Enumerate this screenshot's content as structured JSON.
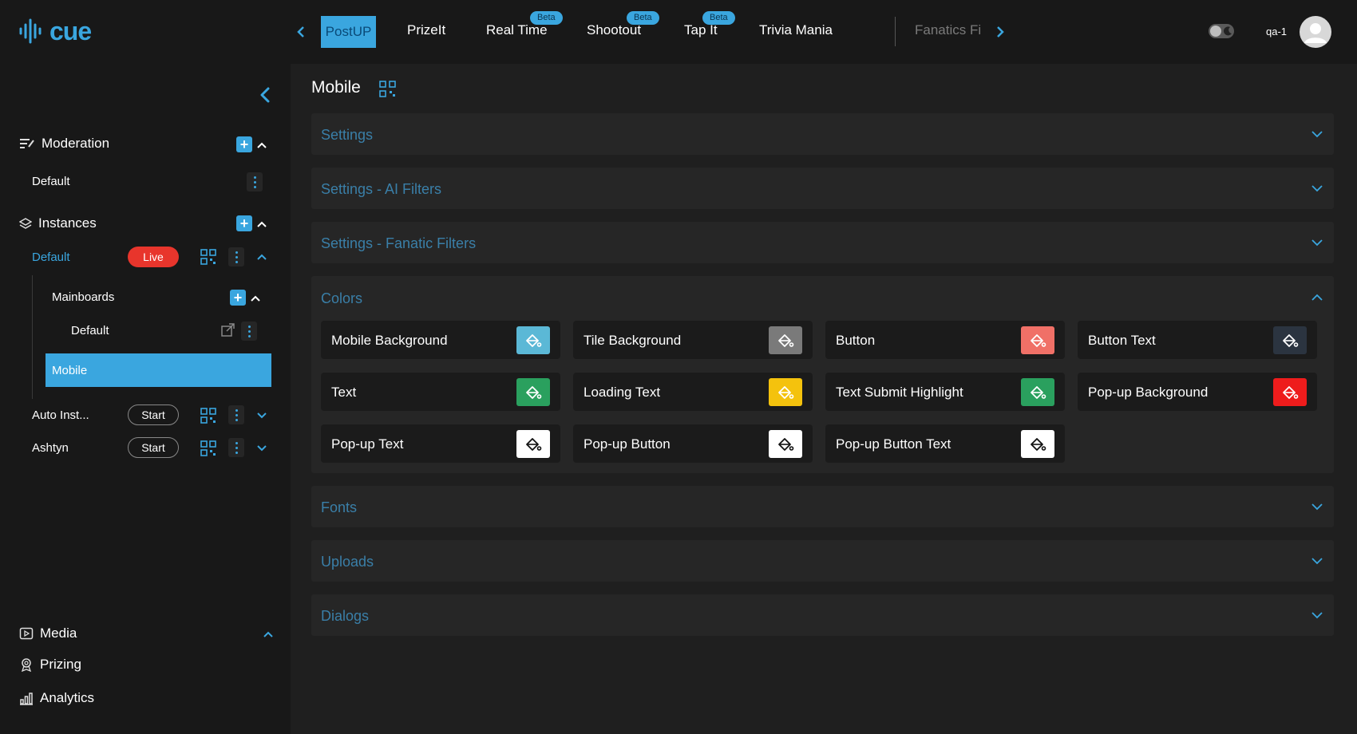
{
  "app": {
    "logo_text": "cue"
  },
  "top_nav": {
    "tabs": [
      {
        "label": "PostUP",
        "active": true
      },
      {
        "label": "PrizeIt"
      },
      {
        "label": "Real Time",
        "badge": "Beta"
      },
      {
        "label": "Shootout",
        "badge": "Beta"
      },
      {
        "label": "Tap It",
        "badge": "Beta"
      },
      {
        "label": "Trivia Mania"
      },
      {
        "label": "Fanatics Fi"
      }
    ],
    "user": "qa-1"
  },
  "sidebar": {
    "moderation": {
      "label": "Moderation",
      "items": [
        {
          "label": "Default"
        }
      ]
    },
    "instances": {
      "label": "Instances",
      "items": [
        {
          "label": "Default",
          "status": "Live"
        },
        {
          "label": "Auto Inst...",
          "status": "Start"
        },
        {
          "label": "Ashtyn",
          "status": "Start"
        }
      ],
      "mainboards": {
        "label": "Mainboards",
        "items": [
          {
            "label": "Default"
          }
        ]
      },
      "selected": {
        "label": "Mobile"
      }
    },
    "bottom": [
      {
        "label": "Media",
        "icon": "media-icon"
      },
      {
        "label": "Prizing",
        "icon": "award-icon"
      },
      {
        "label": "Analytics",
        "icon": "bar-chart-icon"
      }
    ]
  },
  "main": {
    "title": "Mobile",
    "panels": [
      {
        "label": "Settings",
        "expanded": false
      },
      {
        "label": "Settings - AI Filters",
        "expanded": false
      },
      {
        "label": "Settings - Fanatic Filters",
        "expanded": false
      },
      {
        "label": "Colors",
        "expanded": true
      },
      {
        "label": "Fonts",
        "expanded": false
      },
      {
        "label": "Uploads",
        "expanded": false
      },
      {
        "label": "Dialogs",
        "expanded": false
      }
    ],
    "colors": [
      {
        "label": "Mobile Background",
        "color": "#5bb8d6"
      },
      {
        "label": "Tile Background",
        "color": "#7a7a7a"
      },
      {
        "label": "Button",
        "color": "#f07067"
      },
      {
        "label": "Button Text",
        "color": "#2b3440"
      },
      {
        "label": "Text",
        "color": "#2aa05e"
      },
      {
        "label": "Loading Text",
        "color": "#f4c20d"
      },
      {
        "label": "Text Submit Highlight",
        "color": "#2aa05e"
      },
      {
        "label": "Pop-up Background",
        "color": "#ee1c1c"
      },
      {
        "label": "Pop-up Text",
        "color": "#ffffff"
      },
      {
        "label": "Pop-up Button",
        "color": "#ffffff"
      },
      {
        "label": "Pop-up Button Text",
        "color": "#ffffff"
      }
    ]
  },
  "theme": {
    "accent": "#3aa6df",
    "live": "#e8352c"
  }
}
